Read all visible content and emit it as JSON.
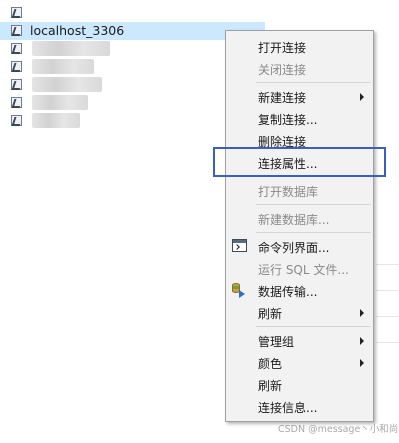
{
  "tree": {
    "selected_connection": "localhost_3306"
  },
  "menu": {
    "items": [
      {
        "label": "打开连接"
      },
      {
        "label": "关闭连接"
      },
      {
        "label": "新建连接"
      },
      {
        "label": "复制连接..."
      },
      {
        "label": "删除连接"
      },
      {
        "label": "连接属性..."
      },
      {
        "label": "打开数据库"
      },
      {
        "label": "新建数据库..."
      },
      {
        "label": "命令列界面..."
      },
      {
        "label": "运行 SQL 文件..."
      },
      {
        "label": "数据传输..."
      },
      {
        "label": "刷新"
      },
      {
        "label": "管理组"
      },
      {
        "label": "颜色"
      },
      {
        "label": "刷新"
      },
      {
        "label": "连接信息..."
      }
    ]
  },
  "watermark": "CSDN @message丶小和尚"
}
